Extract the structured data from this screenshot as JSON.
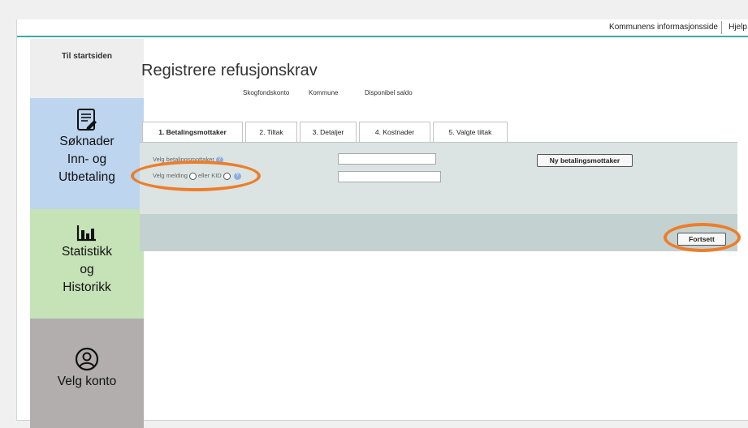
{
  "topbar": {
    "info_link": "Kommunens informasjonsside",
    "help_link": "Hjelp"
  },
  "sidebar": {
    "start": "Til startsiden",
    "soknader": [
      "Søknader",
      "Inn- og",
      "Utbetaling"
    ],
    "statistikk": [
      "Statistikk",
      "og",
      "Historikk"
    ],
    "konto": [
      "Velg konto"
    ],
    "colors": {
      "soknader": "#bdd5ee",
      "statistikk": "#c6e2b7",
      "konto": "#b2aeae"
    }
  },
  "main": {
    "title": "Registrere refusjonskrav",
    "subinfo": [
      "Skogfondskonto",
      "Kommune",
      "Disponibel saldo"
    ],
    "tabs": [
      {
        "label": "1. Betalingsmottaker",
        "active": true
      },
      {
        "label": "2. Tiltak"
      },
      {
        "label": "3. Detaljer"
      },
      {
        "label": "4. Kostnader"
      },
      {
        "label": "5. Valgte tiltak"
      }
    ],
    "form": {
      "payee_label": "Velg betalingsmottaker",
      "payee_value": "",
      "message_label": "Velg melding",
      "or_kid_label": "eller KID",
      "message_value": "",
      "help_icon": "info-icon"
    },
    "buttons": {
      "new_payee": "Ny betalingsmottaker",
      "continue": "Fortsett"
    },
    "highlight_color": "#ec7e2a"
  }
}
